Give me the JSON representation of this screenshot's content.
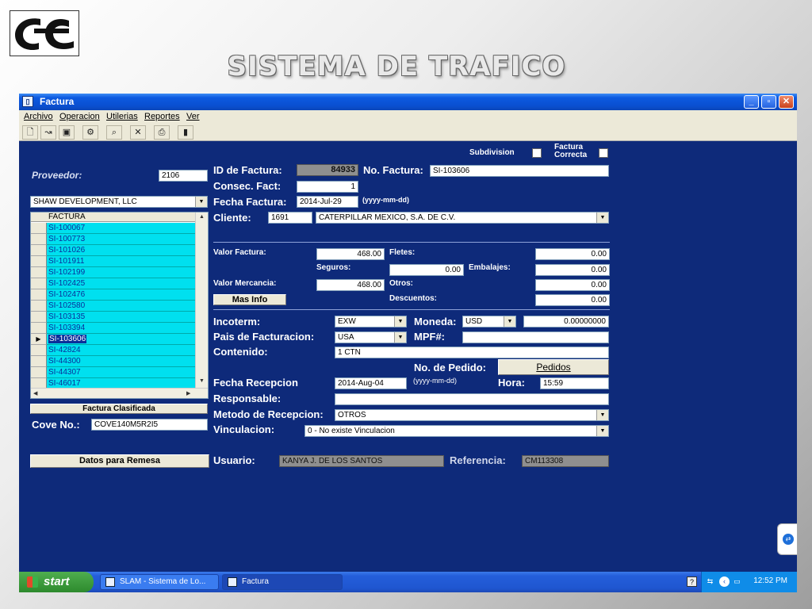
{
  "slide": {
    "title": "SISTEMA DE TRAFICO",
    "logo_icon": "oc-logo-icon"
  },
  "window": {
    "title": "Factura",
    "buttons": [
      "minimize",
      "maximize",
      "close"
    ],
    "menu": [
      "Archivo",
      "Operacion",
      "Utilerias",
      "Reportes",
      "Ver"
    ],
    "toolbar_icons": [
      "new-icon",
      "open-icon",
      "save-icon",
      "settings-icon",
      "search-icon",
      "delete-icon",
      "print-icon",
      "exit-icon"
    ]
  },
  "form": {
    "subdivision_label": "Subdivision",
    "factura_correcta_label_1": "Factura",
    "factura_correcta_label_2": "Correcta",
    "proveedor_label": "Proveedor:",
    "proveedor_value": "2106",
    "proveedor_name": "SHAW DEVELOPMENT, LLC",
    "grid_header": "FACTURA",
    "invoices": [
      "SI-100067",
      "SI-100773",
      "SI-101026",
      "SI-101911",
      "SI-102199",
      "SI-102425",
      "SI-102476",
      "SI-102580",
      "SI-103135",
      "SI-103394",
      "SI-103606",
      "SI-42824",
      "SI-44300",
      "SI-44307",
      "SI-46017"
    ],
    "selected_invoice_index": 10,
    "factura_clasificada": "Factura Clasificada",
    "cove_label": "Cove No.:",
    "cove_value": "COVE140M5R2I5",
    "datos_remesa": "Datos para Remesa",
    "id_factura_label": "ID de Factura:",
    "id_factura_value": "84933",
    "no_factura_label": "No. Factura:",
    "no_factura_value": "SI-103606",
    "consec_label": "Consec. Fact:",
    "consec_value": "1",
    "fecha_factura_label": "Fecha Factura:",
    "fecha_factura_value": "2014-Jul-29",
    "date_hint_1": "(yyyy-mm-dd)",
    "cliente_label": "Cliente:",
    "cliente_value": "1691",
    "cliente_name": "CATERPILLAR MEXICO, S.A. DE C.V.",
    "valor_factura_label": "Valor Factura:",
    "valor_factura_value": "468.00",
    "fletes_label": "Fletes:",
    "fletes_value": "0.00",
    "seguros_label": "Seguros:",
    "seguros_value": "0.00",
    "embalajes_label": "Embalajes:",
    "embalajes_value": "0.00",
    "valor_mercancia_label": "Valor Mercancia:",
    "valor_mercancia_value": "468.00",
    "otros_label": "Otros:",
    "otros_value": "0.00",
    "mas_info": "Mas Info",
    "descuentos_label": "Descuentos:",
    "descuentos_value": "0.00",
    "incoterm_label": "Incoterm:",
    "incoterm_value": "EXW",
    "moneda_label": "Moneda:",
    "moneda_value": "USD",
    "tipo_cambio_value": "0.00000000",
    "pais_label": "Pais de Facturacion:",
    "pais_value": "USA",
    "mpf_label": "MPF#:",
    "mpf_value": "",
    "contenido_label": "Contenido:",
    "contenido_value": "1  CTN",
    "pedido_label": "No.  de Pedido:",
    "pedidos_button": "Pedidos",
    "fecha_recepcion_label": "Fecha Recepcion",
    "fecha_recepcion_value": "2014-Aug-04",
    "date_hint_2": "(yyyy-mm-dd)",
    "hora_label": "Hora:",
    "hora_value": "15:59",
    "responsable_label": "Responsable:",
    "responsable_value": "",
    "metodo_label": "Metodo de Recepcion:",
    "metodo_value": "OTROS",
    "vinculacion_label": "Vinculacion:",
    "vinculacion_value": "0 - No existe Vinculacion",
    "usuario_label": "Usuario:",
    "usuario_value": "KANYA J. DE LOS SANTOS",
    "referencia_label": "Referencia:",
    "referencia_value": "CM113308"
  },
  "taskbar": {
    "start": "start",
    "tasks": [
      "SLAM - Sistema de Lo...",
      "Factura"
    ],
    "clock": "12:52 PM"
  },
  "colors": {
    "window_bg": "#0e2a7a",
    "grid_cell": "#00e0ef",
    "titlebar": "#0a4fd0"
  }
}
